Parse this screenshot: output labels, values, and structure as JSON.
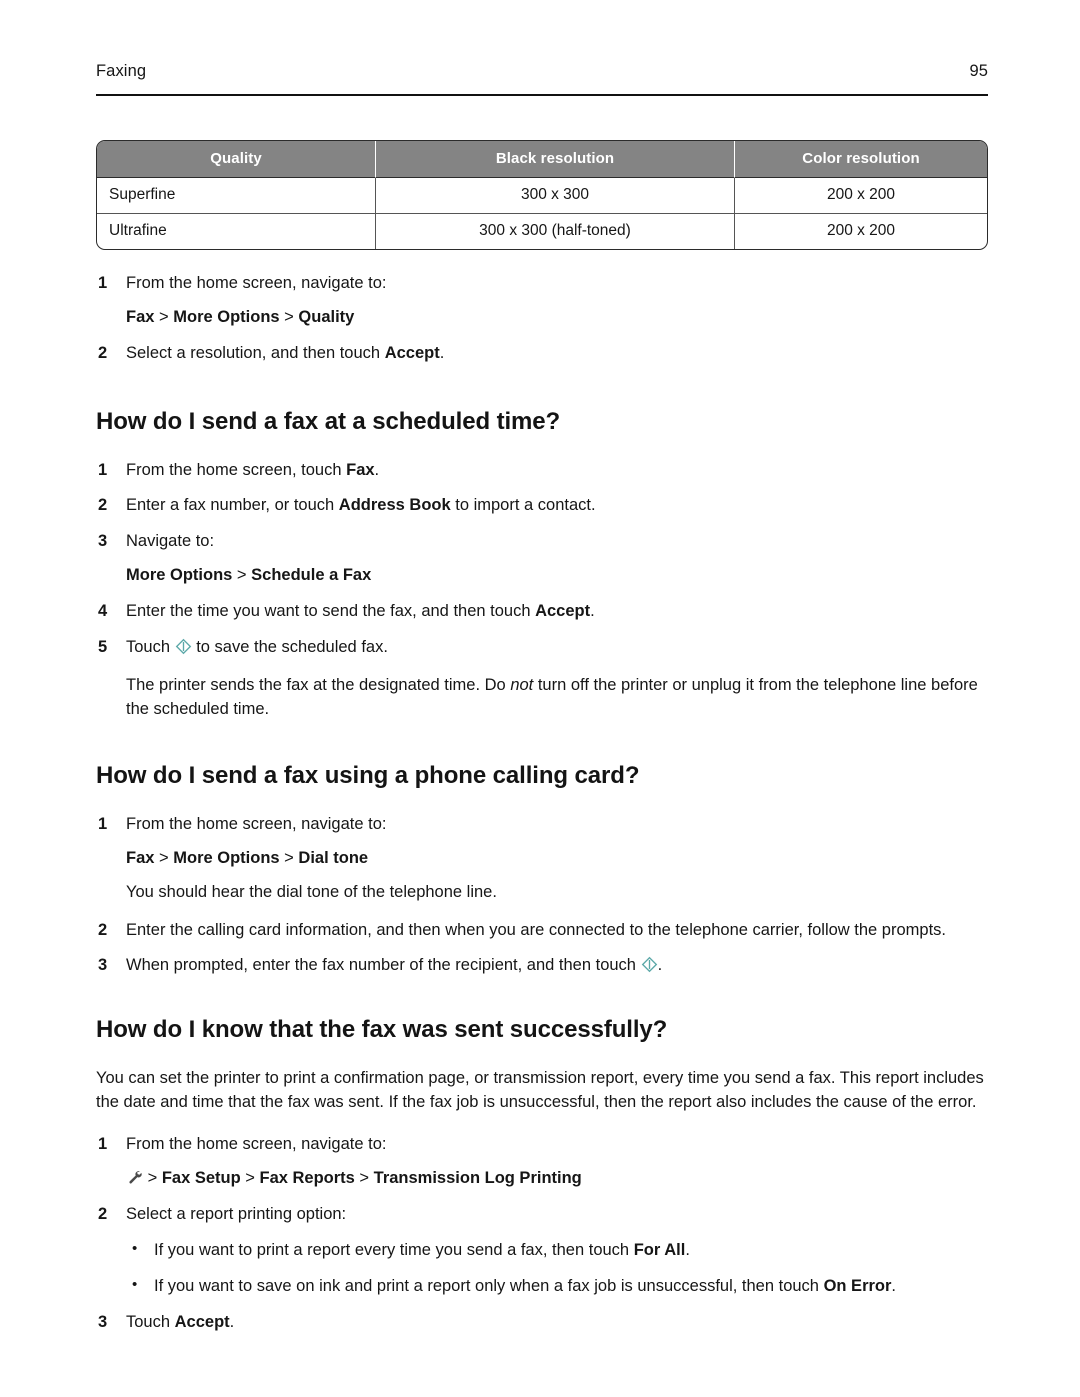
{
  "header": {
    "chapter": "Faxing",
    "page_number": "95"
  },
  "table": {
    "columns": [
      "Quality",
      "Black resolution",
      "Color resolution"
    ],
    "rows": [
      [
        "Superfine",
        "300 x 300",
        "200 x 200"
      ],
      [
        "Ultrafine",
        "300 x 300 (half-toned)",
        "200 x 200"
      ]
    ]
  },
  "quality_steps": {
    "step1": {
      "number": "1",
      "text": "From the home screen, navigate to:",
      "path_parts": [
        "Fax",
        "More Options",
        "Quality"
      ]
    },
    "step2": {
      "number": "2",
      "text_before": "Select a resolution, and then touch ",
      "bold": "Accept",
      "text_after": "."
    }
  },
  "section_scheduled": {
    "heading": "How do I send a fax at a scheduled time?",
    "steps": [
      {
        "number": "1",
        "text_before": "From the home screen, touch ",
        "bold": "Fax",
        "text_after": "."
      },
      {
        "number": "2",
        "text_before": "Enter a fax number, or touch ",
        "bold": "Address Book",
        "text_after": " to import a contact."
      },
      {
        "number": "3",
        "text": "Navigate to:",
        "path_parts": [
          "More Options",
          "Schedule a Fax"
        ]
      },
      {
        "number": "4",
        "text_before": "Enter the time you want to send the fax, and then touch ",
        "bold": "Accept",
        "text_after": "."
      },
      {
        "number": "5",
        "text_before": "Touch ",
        "icon": "send-diamond-icon",
        "text_after": " to save the scheduled fax."
      }
    ],
    "note_parts": {
      "before": "The printer sends the fax at the designated time. Do ",
      "italic": "not",
      "after": " turn off the printer or unplug it from the telephone line before the scheduled time."
    }
  },
  "section_calling_card": {
    "heading": "How do I send a fax using a phone calling card?",
    "step1": {
      "number": "1",
      "text": "From the home screen, navigate to:",
      "path_parts": [
        "Fax",
        "More Options",
        "Dial tone"
      ],
      "follow_text": "You should hear the dial tone of the telephone line."
    },
    "step2": {
      "number": "2",
      "text": "Enter the calling card information, and then when you are connected to the telephone carrier, follow the prompts."
    },
    "step3": {
      "number": "3",
      "text_before": "When prompted, enter the fax number of the recipient, and then touch ",
      "icon": "send-diamond-icon",
      "text_after": "."
    }
  },
  "section_sent_successfully": {
    "heading": "How do I know that the fax was sent successfully?",
    "intro": "You can set the printer to print a confirmation page, or transmission report, every time you send a fax. This report includes the date and time that the fax was sent. If the fax job is unsuccessful, then the report also includes the cause of the error.",
    "step1": {
      "number": "1",
      "text": "From the home screen, navigate to:",
      "icon": "wrench-icon",
      "path_parts": [
        "Fax Setup",
        "Fax Reports",
        "Transmission Log Printing"
      ]
    },
    "step2": {
      "number": "2",
      "text": "Select a report printing option:",
      "bullets": [
        {
          "text_before": "If you want to print a report every time you send a fax, then touch ",
          "bold": "For All",
          "text_after": "."
        },
        {
          "text_before": "If you want to save on ink and print a report only when a fax job is unsuccessful, then touch ",
          "bold": "On Error",
          "text_after": "."
        }
      ]
    },
    "step3": {
      "number": "3",
      "text_before": "Touch ",
      "bold": "Accept",
      "text_after": "."
    }
  },
  "colors": {
    "table_header_bg": "#848484",
    "send_icon": "#5ba8a8",
    "rule": "#111111"
  }
}
